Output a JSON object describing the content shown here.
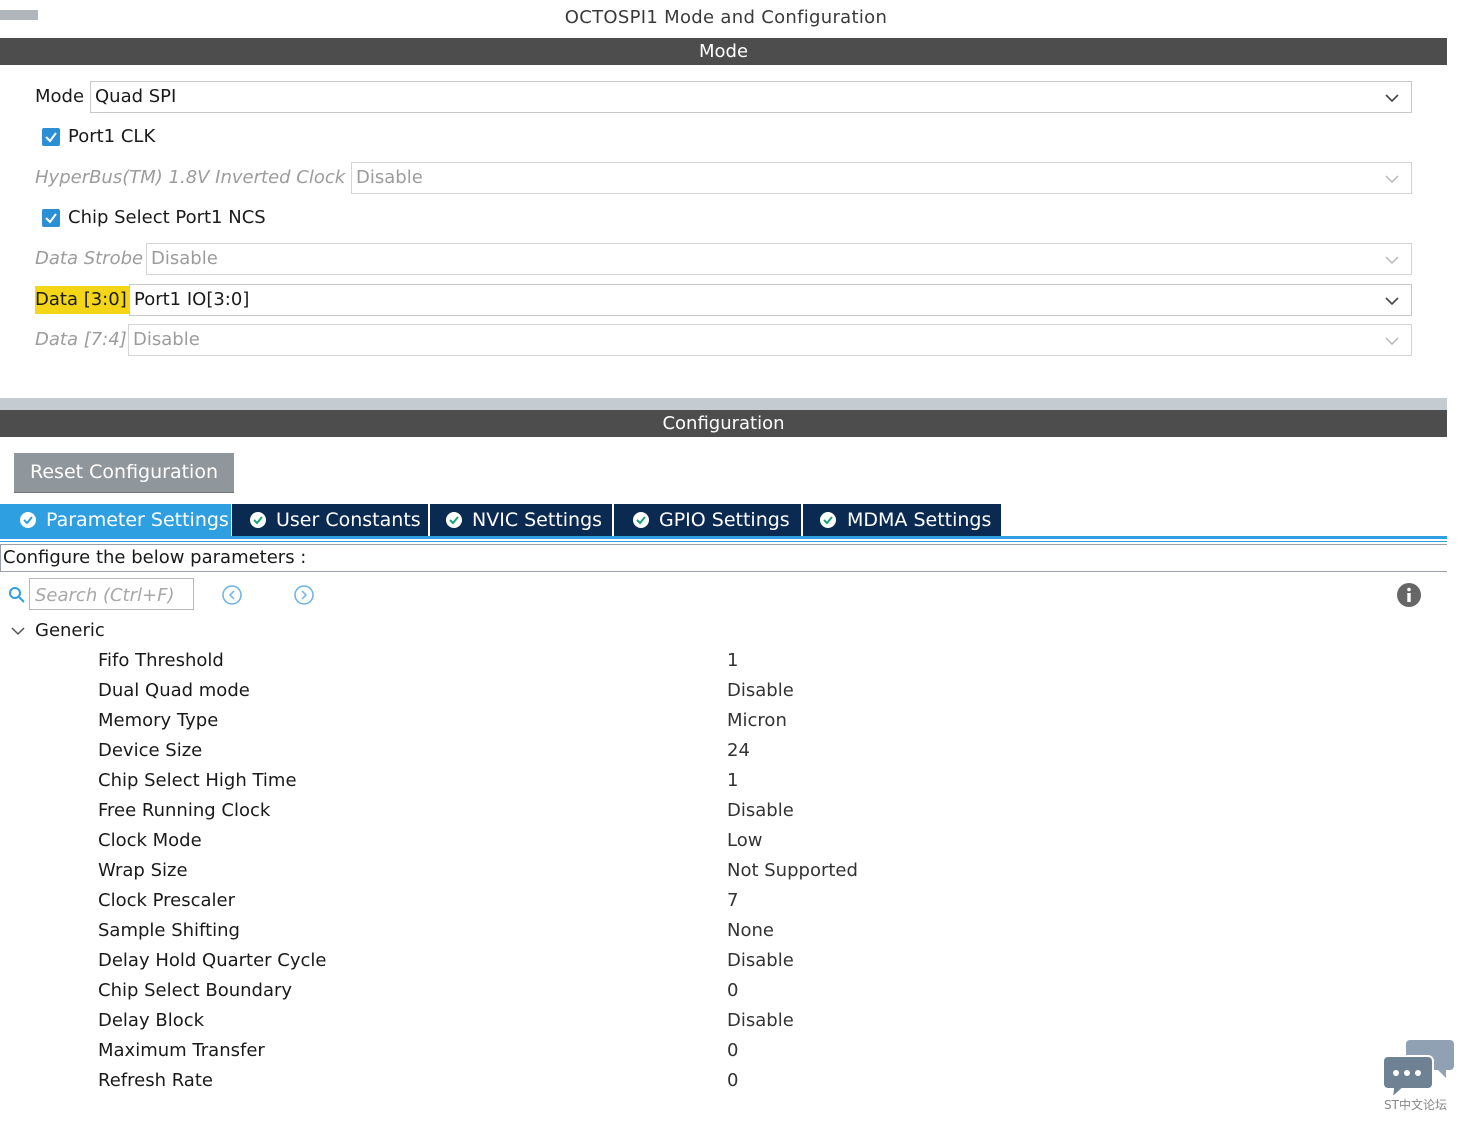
{
  "window_title": "OCTOSPI1 Mode and Configuration",
  "mode_section": {
    "header": "Mode",
    "mode": {
      "label": "Mode",
      "value": "Quad SPI"
    },
    "port1_clk": {
      "label": "Port1 CLK",
      "checked": true
    },
    "hyperbus_clock": {
      "label": "HyperBus(TM) 1.8V Inverted Clock",
      "value": "Disable"
    },
    "chip_select": {
      "label": "Chip Select Port1 NCS",
      "checked": true
    },
    "data_strobe": {
      "label": "Data Strobe",
      "value": "Disable"
    },
    "data_3_0": {
      "label": "Data [3:0]",
      "value": "Port1 IO[3:0]"
    },
    "data_7_4": {
      "label": "Data [7:4]",
      "value": "Disable"
    }
  },
  "config_section": {
    "header": "Configuration",
    "reset_label": "Reset Configuration",
    "tabs": [
      {
        "label": "Parameter Settings",
        "active": true
      },
      {
        "label": "User Constants",
        "active": false
      },
      {
        "label": "NVIC Settings",
        "active": false
      },
      {
        "label": "GPIO Settings",
        "active": false
      },
      {
        "label": "MDMA Settings",
        "active": false
      }
    ],
    "configure_text": "Configure the below parameters :",
    "search_placeholder": "Search (Ctrl+F)",
    "group": "Generic",
    "params": [
      {
        "name": "Fifo Threshold",
        "value": "1"
      },
      {
        "name": "Dual Quad mode",
        "value": "Disable"
      },
      {
        "name": "Memory Type",
        "value": "Micron"
      },
      {
        "name": "Device Size",
        "value": "24"
      },
      {
        "name": "Chip Select High Time",
        "value": "1"
      },
      {
        "name": "Free Running Clock",
        "value": "Disable"
      },
      {
        "name": "Clock Mode",
        "value": "Low"
      },
      {
        "name": "Wrap Size",
        "value": "Not Supported"
      },
      {
        "name": "Clock Prescaler",
        "value": "7"
      },
      {
        "name": "Sample Shifting",
        "value": "None"
      },
      {
        "name": "Delay Hold Quarter Cycle",
        "value": "Disable"
      },
      {
        "name": "Chip Select Boundary",
        "value": "0"
      },
      {
        "name": "Delay Block",
        "value": "Disable"
      },
      {
        "name": "Maximum Transfer",
        "value": "0"
      },
      {
        "name": "Refresh Rate",
        "value": "0"
      }
    ]
  },
  "watermark": "ST中文论坛",
  "colors": {
    "section_bar": "#4d4d4d",
    "tab_active": "#2e9fe0",
    "tab_inactive": "#0b2a52",
    "checkbox": "#2a8fd4",
    "highlight": "#f5d616",
    "reset_button": "#8f969c"
  }
}
